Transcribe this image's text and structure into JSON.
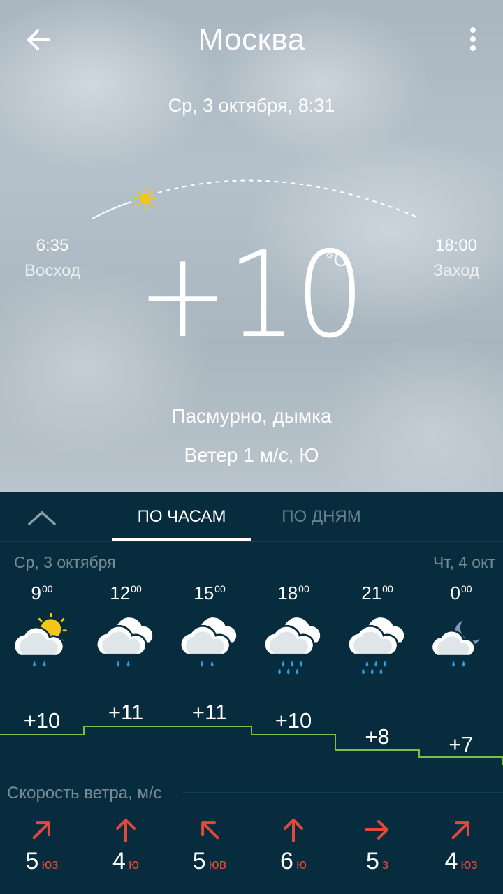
{
  "header": {
    "city": "Москва",
    "date": "Ср, 3 октября, 8:31"
  },
  "sun": {
    "sunrise_time": "6:35",
    "sunrise_label": "Восход",
    "sunset_time": "18:00",
    "sunset_label": "Заход"
  },
  "current": {
    "temperature": "+10",
    "unit": "°C",
    "condition": "Пасмурно, дымка",
    "wind": "Ветер 1 м/с, Ю"
  },
  "tabs": {
    "hourly": "ПО ЧАСАМ",
    "daily": "ПО ДНЯМ"
  },
  "forecast": {
    "day_left": "Ср, 3 октября",
    "day_right": "Чт, 4 окт",
    "hours": [
      {
        "hour": "9",
        "min": "00",
        "temp": "+10",
        "icon": "sun-cloud-rain-icon",
        "wind_speed": "5",
        "wind_dir": "юз"
      },
      {
        "hour": "12",
        "min": "00",
        "temp": "+11",
        "icon": "cloud-rain-icon",
        "wind_speed": "4",
        "wind_dir": "ю"
      },
      {
        "hour": "15",
        "min": "00",
        "temp": "+11",
        "icon": "cloud-rain-icon",
        "wind_speed": "5",
        "wind_dir": "юв"
      },
      {
        "hour": "18",
        "min": "00",
        "temp": "+10",
        "icon": "cloud-heavy-rain-icon",
        "wind_speed": "6",
        "wind_dir": "ю"
      },
      {
        "hour": "21",
        "min": "00",
        "temp": "+8",
        "icon": "cloud-heavy-rain-icon",
        "wind_speed": "5",
        "wind_dir": "з"
      },
      {
        "hour": "0",
        "min": "00",
        "temp": "+7",
        "icon": "moon-cloud-rain-icon",
        "wind_speed": "4",
        "wind_dir": "юз"
      }
    ],
    "wind_title": "Скорость ветра, м/с"
  },
  "colors": {
    "panel_bg": "#062c3d",
    "temp_line": "#7cc242",
    "wind_arrow": "#e0493c"
  }
}
